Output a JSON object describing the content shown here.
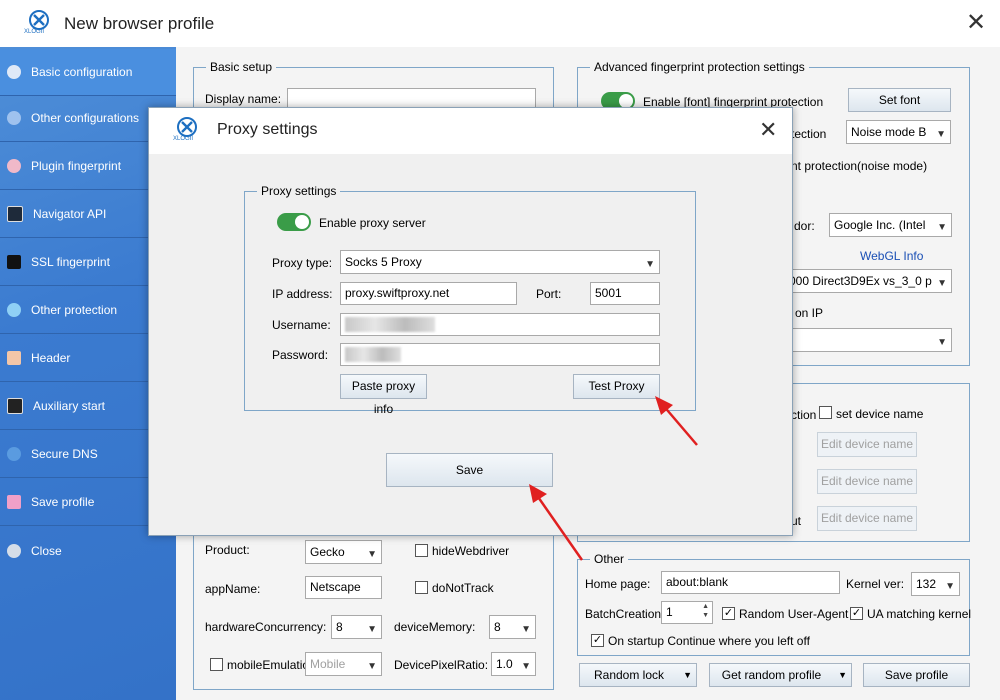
{
  "window": {
    "title": "New browser profile",
    "logo_text": "XLOGII"
  },
  "sidebar": {
    "items": [
      {
        "label": "Basic configuration",
        "icon": "compass-icon"
      },
      {
        "label": "Other configurations",
        "icon": "chrome-icon"
      },
      {
        "label": "Plugin fingerprint",
        "icon": "plugin-icon"
      },
      {
        "label": "Navigator API",
        "icon": "api-icon"
      },
      {
        "label": "SSL fingerprint",
        "icon": "lock-icon"
      },
      {
        "label": "Other protection",
        "icon": "shield-icon"
      },
      {
        "label": "Header",
        "icon": "header-icon"
      },
      {
        "label": "Auxiliary start",
        "icon": "cmd-icon"
      },
      {
        "label": "Secure DNS",
        "icon": "dns-icon"
      },
      {
        "label": "Save profile",
        "icon": "save-icon"
      },
      {
        "label": "Close",
        "icon": "close-icon"
      }
    ]
  },
  "basic_setup": {
    "legend": "Basic setup",
    "display_name_label": "Display name:",
    "display_name_value": ""
  },
  "navigator": {
    "product_label": "Product:",
    "product_value": "Gecko",
    "hide_webdriver_label": "hideWebdriver",
    "appname_label": "appName:",
    "appname_value": "Netscape",
    "donottrack_label": "doNotTrack",
    "hwc_label": "hardwareConcurrency:",
    "hwc_value": "8",
    "devmem_label": "deviceMemory:",
    "devmem_value": "8",
    "mobile_label": "mobileEmulatio",
    "mobile_value": "Mobile",
    "dpr_label": "DevicePixelRatio:",
    "dpr_value": "1.0"
  },
  "advanced": {
    "legend": "Advanced fingerprint protection settings",
    "font_label": "Enable [font] fingerprint protection",
    "set_font_button": "Set font",
    "tection_label": "tection",
    "noise_mode_value": "Noise mode B",
    "nt_protection_label": "nt  protection(noise mode)",
    "dor_label": "dor:",
    "vendor_value": "Google Inc. (Intel",
    "webgl_info_link": "WebGL Info",
    "renderer_value": "000 Direct3D9Ex vs_3_0 p",
    "on_ip_label": "on IP",
    "ip_select_value": ""
  },
  "device": {
    "ction_label": "ction",
    "set_device_name_label": "set device name",
    "edit_device_buttons": [
      "Edit device name",
      "Edit device name",
      "Edit device name"
    ],
    "ut_label": "ut"
  },
  "other": {
    "legend": "Other",
    "home_page_label": "Home page:",
    "home_page_value": "about:blank",
    "kernel_label": "Kernel ver:",
    "kernel_value": "132",
    "batch_label": "BatchCreation:",
    "batch_value": "1",
    "random_ua_label": "Random User-Agent",
    "ua_matching_label": "UA matching kernel",
    "startup_label": "On startup Continue where you left off"
  },
  "bottom_buttons": {
    "random_lock": "Random lock",
    "get_random_profile": "Get random profile",
    "save_profile": "Save profile"
  },
  "dialog": {
    "title": "Proxy settings",
    "logo_text": "XLOGII",
    "group_legend": "Proxy settings",
    "enable_proxy_label": "Enable proxy server",
    "proxy_type_label": "Proxy type:",
    "proxy_type_value": "Socks 5 Proxy",
    "ip_label": "IP address:",
    "ip_value": "proxy.swiftproxy.net",
    "port_label": "Port:",
    "port_value": "5001",
    "username_label": "Username:",
    "password_label": "Password:",
    "paste_button": "Paste proxy info",
    "test_button": "Test Proxy",
    "save_button": "Save"
  },
  "colors": {
    "sidebar": "#3b7bd0",
    "toggle_on": "#3a9c48",
    "arrow": "#e02020",
    "link": "#1a4fb5"
  }
}
